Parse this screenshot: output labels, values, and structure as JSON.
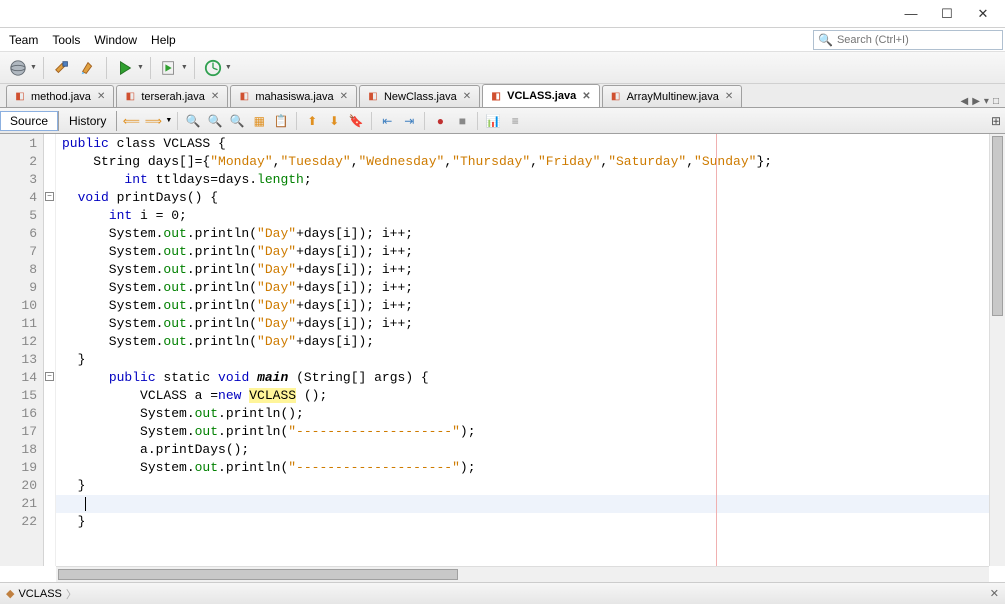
{
  "menu": {
    "items": [
      "Team",
      "Tools",
      "Window",
      "Help"
    ]
  },
  "search": {
    "placeholder": "Search (Ctrl+I)"
  },
  "tabs": [
    {
      "label": "method.java",
      "active": false
    },
    {
      "label": "terserah.java",
      "active": false
    },
    {
      "label": "mahasiswa.java",
      "active": false
    },
    {
      "label": "NewClass.java",
      "active": false
    },
    {
      "label": "VCLASS.java",
      "active": true
    },
    {
      "label": "ArrayMultinew.java",
      "active": false
    }
  ],
  "viewtabs": {
    "source": "Source",
    "history": "History"
  },
  "lines": [
    "1",
    "2",
    "3",
    "4",
    "5",
    "6",
    "7",
    "8",
    "9",
    "10",
    "11",
    "12",
    "13",
    "14",
    "15",
    "16",
    "17",
    "18",
    "19",
    "20",
    "21",
    "22"
  ],
  "code": {
    "l1a": "public",
    "l1b": " class ",
    "l1c": "VCLASS",
    "l1d": " {",
    "l2a": "    String days[]={",
    "l2b": "\"Monday\"",
    "l2c": ",",
    "l2d": "\"Tuesday\"",
    "l2e": ",",
    "l2f": "\"Wednesday\"",
    "l2g": ",",
    "l2h": "\"Thursday\"",
    "l2i": ",",
    "l2j": "\"Friday\"",
    "l2k": ",",
    "l2l": "\"Saturday\"",
    "l2m": ",",
    "l2n": "\"Sunday\"",
    "l2o": "};",
    "l3a": "        ",
    "l3b": "int",
    "l3c": " ttldays=days.",
    "l3d": "length",
    "l3e": ";",
    "l4a": "  ",
    "l4b": "void",
    "l4c": " printDays() {",
    "l5a": "      ",
    "l5b": "int",
    "l5c": " i = 0;",
    "l6a": "      System.",
    "l6b": "out",
    "l6c": ".println(",
    "l6d": "\"Day\"",
    "l6e": "+days[i]); i++;",
    "l12a": "      System.",
    "l12b": "out",
    "l12c": ".println(",
    "l12d": "\"Day\"",
    "l12e": "+days[i]);",
    "l13": "  }",
    "l14a": "      ",
    "l14b": "public",
    "l14c": " static ",
    "l14d": "void",
    "l14e": " ",
    "l14f": "main",
    "l14g": " (String[] args) {",
    "l15a": "          VCLASS a =",
    "l15b": "new",
    "l15c": " ",
    "l15d": "VCLASS",
    "l15e": " ();",
    "l16a": "          System.",
    "l16b": "out",
    "l16c": ".println();",
    "l17a": "          System.",
    "l17b": "out",
    "l17c": ".println(",
    "l17d": "\"--------------------\"",
    "l17e": ");",
    "l18": "          a.printDays();",
    "l19a": "          System.",
    "l19b": "out",
    "l19c": ".println(",
    "l19d": "\"--------------------\"",
    "l19e": ");",
    "l20": "  }",
    "l21": "   ",
    "l22": "  }"
  },
  "breadcrumb": {
    "label": "VCLASS"
  }
}
